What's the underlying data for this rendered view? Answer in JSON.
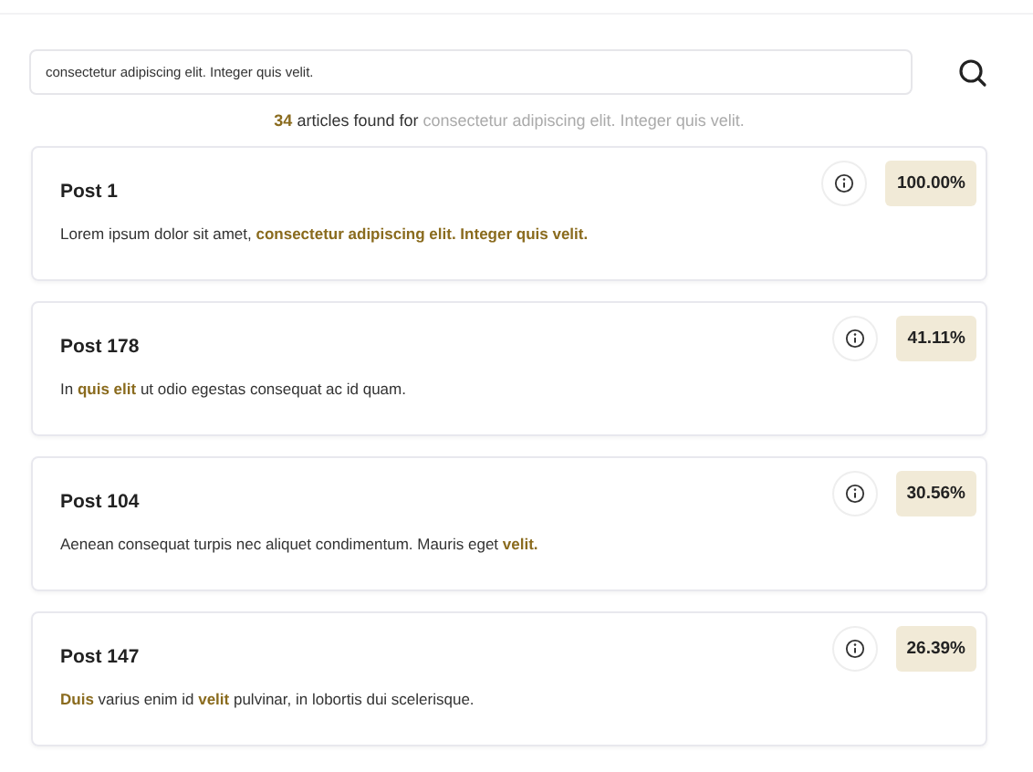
{
  "search": {
    "value": "consectetur adipiscing elit. Integer quis velit."
  },
  "summary": {
    "count": "34",
    "text": "articles found for",
    "query": "consectetur adipiscing elit. Integer quis velit."
  },
  "results": [
    {
      "title": "Post 1",
      "score": "100.00%",
      "snippet": "Lorem ipsum dolor sit amet, **consectetur adipiscing elit. Integer quis velit.**"
    },
    {
      "title": "Post 178",
      "score": "41.11%",
      "snippet": "In **quis elit** ut odio egestas consequat ac id quam."
    },
    {
      "title": "Post 104",
      "score": "30.56%",
      "snippet": "Aenean consequat turpis nec aliquet condimentum. Mauris eget **velit.**"
    },
    {
      "title": "Post 147",
      "score": "26.39%",
      "snippet": "**Duis** varius enim id **velit** pulvinar, in lobortis dui scelerisque."
    }
  ]
}
